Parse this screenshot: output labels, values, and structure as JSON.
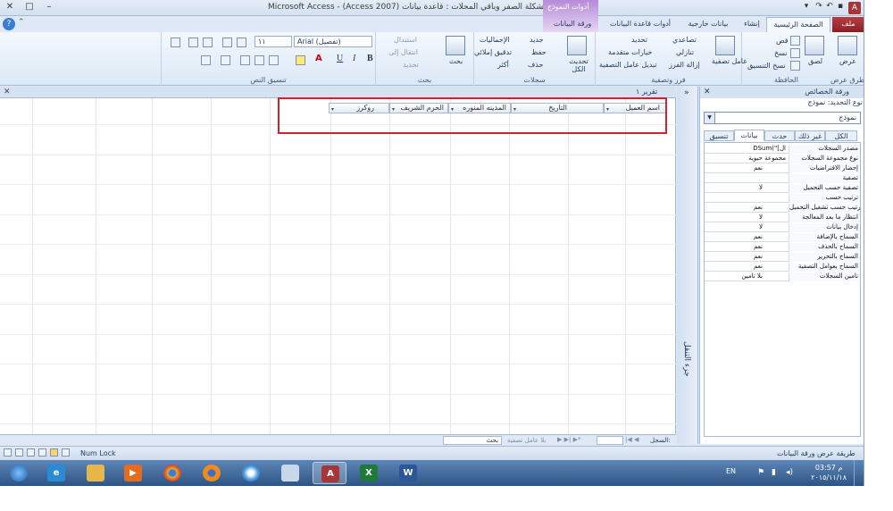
{
  "window": {
    "title": "Microsoft Access - (Access 2007) مشكلة الصفر وباقي المحلات : قاعدة بيانات",
    "context_tab_header": "أدوات النموذج",
    "app_icon": "A"
  },
  "tabs": {
    "file": "ملف",
    "home": "الصفحة الرئيسية",
    "create": "إنشاء",
    "external": "بيانات خارجية",
    "dbtools": "أدوات قاعدة البيانات",
    "datasheet": "ورقة البيانات"
  },
  "ribbon": {
    "views": {
      "view": "عرض",
      "label": "طرق عرض"
    },
    "clipboard": {
      "paste": "لصق",
      "cut": "قص",
      "copy": "نسخ",
      "format_painter": "نسخ التنسيق",
      "label": "الحافظة"
    },
    "sort_filter": {
      "filter": "عامل تصفية",
      "ascending": "تصاعدي",
      "descending": "تنازلي",
      "remove_sort": "إزالة الفرز",
      "selection": "تحديد",
      "advanced": "خيارات متقدمة",
      "toggle_filter": "تبديل عامل التصفية",
      "label": "فرز وتصفية"
    },
    "records": {
      "refresh": "تحديث الكل",
      "new": "جديد",
      "save": "حفظ",
      "delete": "حذف",
      "totals": "الإجماليات",
      "spelling": "تدقيق إملائي",
      "more": "أكثر",
      "label": "سجلات"
    },
    "find": {
      "find": "بحث",
      "replace": "استبدال",
      "goto": "انتقال إلى",
      "select": "تحديد",
      "label": "بحث"
    },
    "text_format": {
      "font": "Arial (تفصيل)",
      "size": "١١",
      "bold": "B",
      "italic": "I",
      "underline": "U",
      "label": "تنسيق النص"
    }
  },
  "document": {
    "tab_title": "تقرير ١",
    "columns": [
      {
        "label": "اسم العميل"
      },
      {
        "label": "التاريخ"
      },
      {
        "label": "المدينه المنوره"
      },
      {
        "label": "الحرم الشريف"
      },
      {
        "label": "روكرز"
      }
    ]
  },
  "nav_pane": {
    "label": "جزء التنقل",
    "toggle": "»"
  },
  "property_sheet": {
    "title": "ورقة الخصائص",
    "selection_type": "نوع التحديد: نموذج",
    "selected_object": "نموذج",
    "tabs": [
      "الكل",
      "غير ذلك",
      "حدث",
      "بيانات",
      "تنسيق"
    ],
    "active_tab": "بيانات",
    "rows": [
      {
        "name": "مصدر السجلات",
        "value": "DSum(\"[ال"
      },
      {
        "name": "نوع مجموعة السجلات",
        "value": "مجموعة حيوية"
      },
      {
        "name": "إحضار الافتراضيات",
        "value": "نعم"
      },
      {
        "name": "تصفية",
        "value": ""
      },
      {
        "name": "تصفية حسب التحميل",
        "value": "لا"
      },
      {
        "name": "ترتيب حسب",
        "value": ""
      },
      {
        "name": "ترتيب حسب تشغيل التحميل",
        "value": "نعم"
      },
      {
        "name": "انتظار ما بعد المعالجة",
        "value": "لا"
      },
      {
        "name": "إدخال بيانات",
        "value": "لا"
      },
      {
        "name": "السماح بالإضافة",
        "value": "نعم"
      },
      {
        "name": "السماح بالحذف",
        "value": "نعم"
      },
      {
        "name": "السماح بالتحرير",
        "value": "نعم"
      },
      {
        "name": "السماح بعوامل التصفية",
        "value": "نعم"
      },
      {
        "name": "تأمين السجلات",
        "value": "بلا تأمين"
      }
    ]
  },
  "record_nav": {
    "label": "السجل:",
    "no_filter": "بلا عامل تصفية",
    "search": "بحث"
  },
  "statusbar": {
    "left": "طريقة عرض ورقة البيانات",
    "num_lock": "Num Lock"
  },
  "taskbar": {
    "lang": "EN",
    "time": "03:57 م",
    "date": "٢٠١٥/١١/١٨",
    "apps": [
      "start-orb",
      "internet-explorer",
      "file-explorer",
      "media-player",
      "chrome",
      "firefox",
      "app-swirl",
      "paint",
      "access",
      "excel",
      "word"
    ]
  }
}
